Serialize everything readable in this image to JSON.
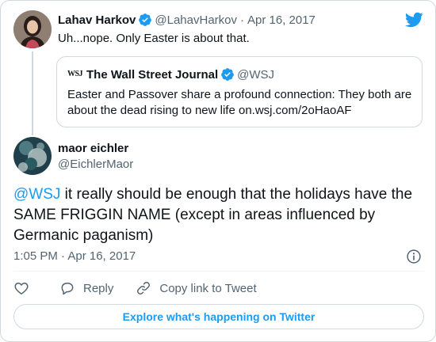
{
  "colors": {
    "accent": "#1d9bf0",
    "text": "#0f1419",
    "muted": "#536471",
    "border": "#cfd9de"
  },
  "parent_tweet": {
    "display_name": "Lahav Harkov",
    "handle": "@LahavHarkov",
    "separator": "·",
    "date": "Apr 16, 2017",
    "text": "Uh...nope. Only Easter is about that.",
    "verified": true
  },
  "quoted_tweet": {
    "display_name": "The Wall Street Journal",
    "handle": "@WSJ",
    "logo_text": "WSJ",
    "verified": true,
    "text": "Easter and Passover share a profound connection: They both are about the dead rising to new life on.wsj.com/2oHaoAF"
  },
  "main_tweet": {
    "display_name": "maor eichler",
    "handle": "@EichlerMaor",
    "mention": "@WSJ",
    "text": " it really should be enough that the holidays have the SAME FRIGGIN NAME (except in areas influenced by Germanic paganism)",
    "timestamp": "1:05 PM · Apr 16, 2017"
  },
  "actions": {
    "like_icon": "heart-icon",
    "reply_label": "Reply",
    "reply_icon": "speech-bubble-icon",
    "copy_link_label": "Copy link to Tweet",
    "copy_link_icon": "link-icon"
  },
  "explore_label": "Explore what's happening on Twitter"
}
